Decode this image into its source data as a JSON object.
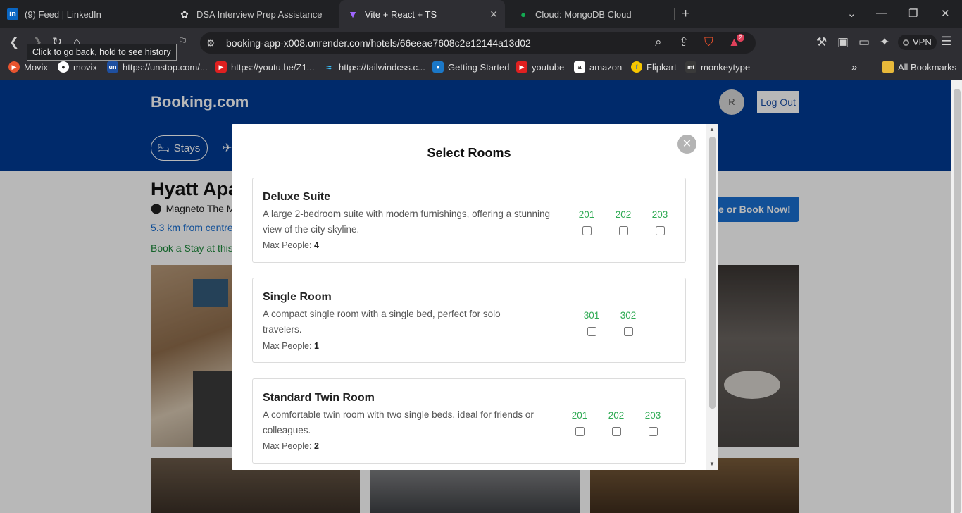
{
  "browser": {
    "tabs": [
      {
        "title": "(9) Feed | LinkedIn",
        "icon": "linkedin-icon"
      },
      {
        "title": "DSA Interview Prep Assistance",
        "icon": "openai-icon"
      },
      {
        "title": "Vite + React + TS",
        "icon": "vite-icon",
        "active": true
      },
      {
        "title": "Cloud: MongoDB Cloud",
        "icon": "mongodb-icon"
      }
    ],
    "address": "booking-app-x008.onrender.com/hotels/66eeae7608c2e12144a13d02",
    "back_tooltip": "Click to go back, hold to see history",
    "alert_count": "2",
    "vpn_label": "VPN",
    "bookmarks": [
      {
        "label": "Movix",
        "icon": "movix-icon",
        "color": "#e8542f"
      },
      {
        "label": "movix",
        "icon": "github-icon",
        "color": "#444444"
      },
      {
        "label": "https://unstop.com/...",
        "icon": "unstop-icon",
        "color": "#1e4fa0"
      },
      {
        "label": "https://youtu.be/Z1...",
        "icon": "youtube-icon",
        "color": "#e02020"
      },
      {
        "label": "https://tailwindcss.c...",
        "icon": "tailwind-icon",
        "color": "#38bdf8"
      },
      {
        "label": "Getting Started",
        "icon": "bookmark-icon",
        "color": "#1b78c8"
      },
      {
        "label": "youtube",
        "icon": "youtube-icon",
        "color": "#e02020"
      },
      {
        "label": "amazon",
        "icon": "amazon-icon",
        "color": "#ffffff"
      },
      {
        "label": "Flipkart",
        "icon": "flipkart-icon",
        "color": "#f7c600"
      },
      {
        "label": "monkeytype",
        "icon": "monkeytype-icon",
        "color": "#3a3a3a"
      }
    ],
    "all_bookmarks": "All Bookmarks"
  },
  "site": {
    "logo": "Booking.com",
    "avatar_initial": "R",
    "logout_label": "Log Out",
    "nav_stays": "Stays"
  },
  "hotel": {
    "name": "Hyatt Apa",
    "address": "Magneto The M",
    "distance": "5.3 km from centre",
    "tagline": "Book a Stay at this",
    "reserve_label": "ve or Book Now!"
  },
  "modal": {
    "title": "Select Rooms",
    "close_symbol": "✕",
    "max_people_label": "Max People:",
    "rooms": [
      {
        "name": "Deluxe Suite",
        "description": "A large 2-bedroom suite with modern furnishings, offering a stunning view of the city skyline.",
        "max_people": "4",
        "numbers": [
          "201",
          "202",
          "203"
        ]
      },
      {
        "name": "Single Room",
        "description": "A compact single room with a single bed, perfect for solo travelers.",
        "max_people": "1",
        "numbers": [
          "301",
          "302"
        ]
      },
      {
        "name": "Standard Twin Room",
        "description": "A comfortable twin room with two single beds, ideal for friends or colleagues.",
        "max_people": "2",
        "numbers": [
          "201",
          "202",
          "203"
        ]
      }
    ]
  },
  "colors": {
    "brand_blue": "#003b95",
    "room_number_green": "#2eaa53",
    "link_blue": "#1a6fd1"
  }
}
